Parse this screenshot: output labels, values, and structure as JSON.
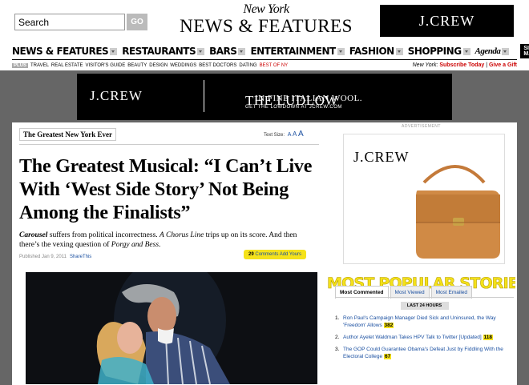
{
  "search": {
    "value": "Search",
    "button": "GO"
  },
  "masthead": {
    "ny": "New York",
    "section": "NEWS & FEATURES"
  },
  "top_ad": {
    "brand": "J.CREW"
  },
  "nav": {
    "items": [
      "NEWS & FEATURES",
      "RESTAURANTS",
      "BARS",
      "ENTERTAINMENT",
      "FASHION",
      "SHOPPING"
    ],
    "agenda": "Agenda",
    "sitemap": "SITE MAP"
  },
  "subnav": {
    "plus": "PLUS",
    "items": [
      "TRAVEL",
      "REAL ESTATE",
      "VISITOR'S GUIDE",
      "BEAUTY",
      "DESIGN",
      "WEDDINGS",
      "BEST DOCTORS",
      "DATING"
    ],
    "best_of": "BEST OF NY",
    "ny_label": "New York:",
    "subscribe": "Subscribe Today",
    "sep": "|",
    "gift": "Give a Gift"
  },
  "ludlow_ad": {
    "brand": "J.CREW",
    "headline": "THE LUDLOW",
    "sub1": "IN FINE ITALIAN WOOL.",
    "sub2": "GET THE LOWDOWN AT JCREW.COM"
  },
  "article": {
    "series": "The Greatest New York Ever",
    "text_size_label": "Text Size:",
    "sizes": [
      "A",
      "A",
      "A"
    ],
    "headline": "The Greatest Musical: “I Can’t Live With ‘West Side Story’ Not Being Among the Finalists”",
    "dek_parts": {
      "p1": "Carousel",
      "p2": " suffers from political incorrectness. ",
      "p3": "A Chorus Line",
      "p4": " trips up on its score. And then there’s the vexing question of ",
      "p5": "Porgy and Bess",
      "p6": "."
    },
    "published": "Published Jan 9, 2011",
    "share": "ShareThis",
    "comments_count": "29",
    "comments_link": "Comments Add Yours"
  },
  "side_ad": {
    "label": "ADVERTISEMENT",
    "brand": "J.CREW"
  },
  "most_popular": {
    "title": "MOST POPULAR STORIES",
    "tabs": [
      "Most Commented",
      "Most Viewed",
      "Most Emailed"
    ],
    "window": "LAST 24 HOURS",
    "items": [
      {
        "num": "1.",
        "text": "Ron Paul's Campaign Manager Died Sick and Uninsured, the Way 'Freedom' Allows",
        "count": "382"
      },
      {
        "num": "2.",
        "text": "Author Ayelet Waldman Takes HPV Talk to Twitter [Updated]",
        "count": "118"
      },
      {
        "num": "3.",
        "text": "The GOP Could Guarantee Obama's Defeat Just by Fiddling With the Electoral College",
        "count": "67"
      }
    ]
  },
  "colors": {
    "accent_yellow": "#f5e21a",
    "link_blue": "#1a4fa0",
    "red": "#cc0000",
    "band_gray": "#666666"
  }
}
